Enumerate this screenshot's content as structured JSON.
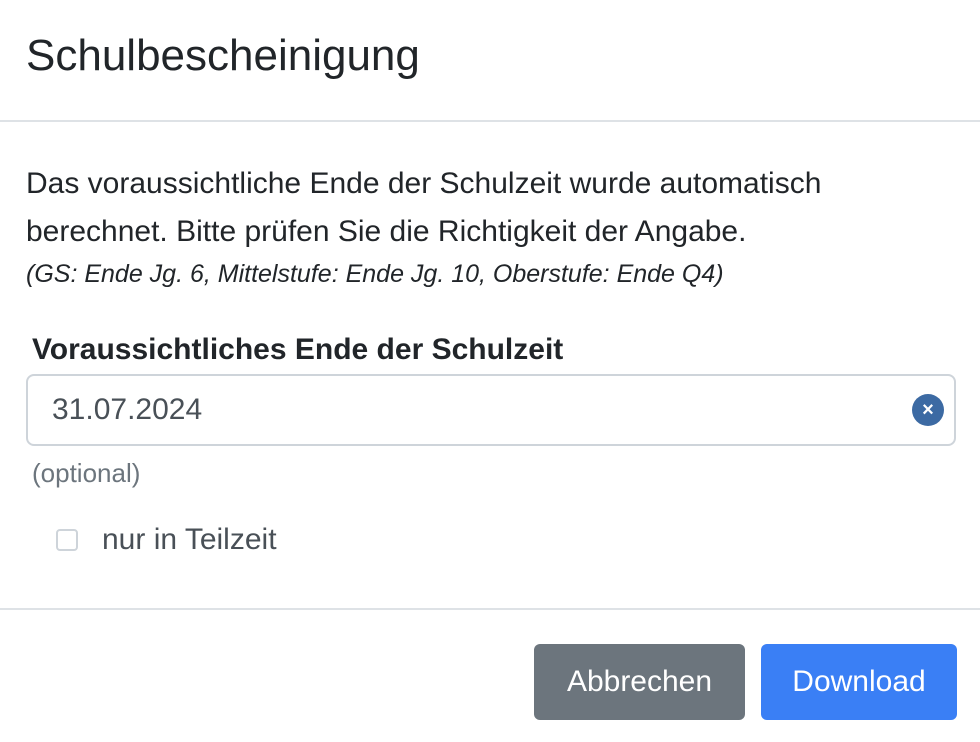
{
  "modal": {
    "title": "Schulbescheinigung"
  },
  "body": {
    "intro": "Das voraussichtliche Ende der Schulzeit wurde automatisch berechnet. Bitte prüfen Sie die Richtigkeit der Angabe.",
    "hint": "(GS: Ende Jg. 6, Mittelstufe: Ende Jg. 10, Oberstufe: Ende Q4)",
    "end_date": {
      "label": "Voraussichtliches Ende der Schulzeit",
      "value": "31.07.2024",
      "clear_icon": "×",
      "helper": "(optional)"
    },
    "part_time": {
      "label": "nur in Teilzeit",
      "checked": false
    }
  },
  "footer": {
    "cancel_label": "Abbrechen",
    "download_label": "Download"
  },
  "colors": {
    "primary": "#3a7ff5",
    "secondary": "#6c757d",
    "clear_button": "#3c6aa3"
  }
}
